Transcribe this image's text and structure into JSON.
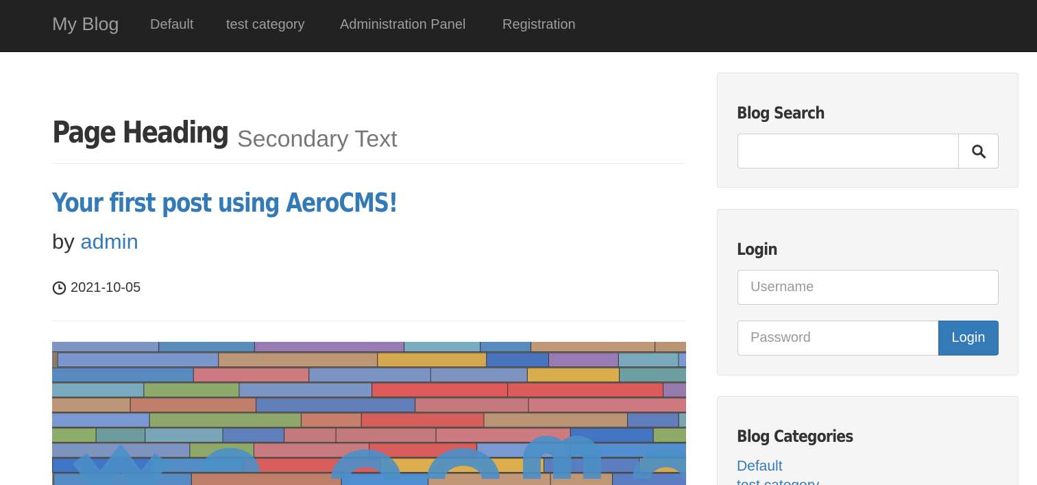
{
  "navbar": {
    "brand": "My Blog",
    "items": [
      "Default",
      "test category",
      "Administration Panel",
      "Registration"
    ]
  },
  "heading": {
    "main": "Page Heading",
    "secondary": "Secondary Text"
  },
  "post": {
    "title": "Your first post using AeroCMS!",
    "by_label": "by",
    "author": "admin",
    "date": "2021-10-05",
    "image_icon": "welcome-wood-image"
  },
  "search": {
    "title": "Blog Search",
    "value": "",
    "button_icon": "search-icon"
  },
  "login": {
    "title": "Login",
    "username_placeholder": "Username",
    "password_placeholder": "Password",
    "button_label": "Login"
  },
  "categories": {
    "title": "Blog Categories",
    "items": [
      "Default",
      "test category"
    ]
  },
  "colors": {
    "navbar_bg": "#222222",
    "link": "#337ab7",
    "primary_button": "#337ab7"
  }
}
